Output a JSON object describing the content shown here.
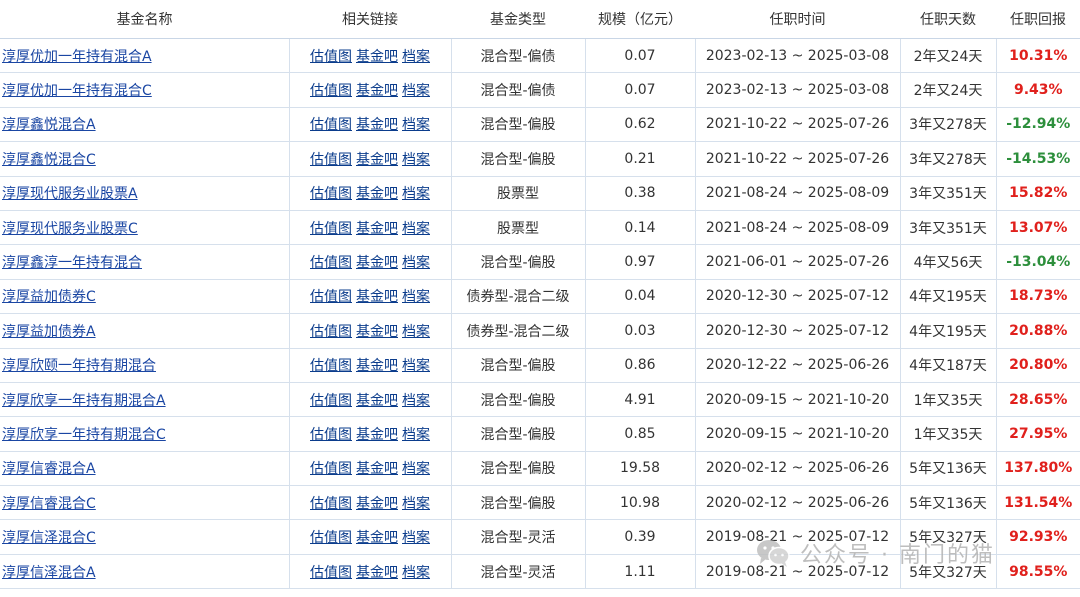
{
  "columns": {
    "name": "基金名称",
    "links": "相关链接",
    "type": "基金类型",
    "size": "规模（亿元）",
    "period": "任职时间",
    "days": "任职天数",
    "ret": "任职回报"
  },
  "link_labels": [
    "估值图",
    "基金吧",
    "档案"
  ],
  "colors": {
    "positive": "#e0201c",
    "negative": "#2d8f3c",
    "link": "#0b3c8c"
  },
  "rows": [
    {
      "name": "淳厚优加一年持有混合A",
      "type": "混合型-偏债",
      "size": "0.07",
      "period": "2023-02-13 ~ 2025-03-08",
      "days": "2年又24天",
      "ret": "10.31%",
      "sign": "pos"
    },
    {
      "name": "淳厚优加一年持有混合C",
      "type": "混合型-偏债",
      "size": "0.07",
      "period": "2023-02-13 ~ 2025-03-08",
      "days": "2年又24天",
      "ret": "9.43%",
      "sign": "pos"
    },
    {
      "name": "淳厚鑫悦混合A",
      "type": "混合型-偏股",
      "size": "0.62",
      "period": "2021-10-22 ~ 2025-07-26",
      "days": "3年又278天",
      "ret": "-12.94%",
      "sign": "neg"
    },
    {
      "name": "淳厚鑫悦混合C",
      "type": "混合型-偏股",
      "size": "0.21",
      "period": "2021-10-22 ~ 2025-07-26",
      "days": "3年又278天",
      "ret": "-14.53%",
      "sign": "neg"
    },
    {
      "name": "淳厚现代服务业股票A",
      "type": "股票型",
      "size": "0.38",
      "period": "2021-08-24 ~ 2025-08-09",
      "days": "3年又351天",
      "ret": "15.82%",
      "sign": "pos"
    },
    {
      "name": "淳厚现代服务业股票C",
      "type": "股票型",
      "size": "0.14",
      "period": "2021-08-24 ~ 2025-08-09",
      "days": "3年又351天",
      "ret": "13.07%",
      "sign": "pos"
    },
    {
      "name": "淳厚鑫淳一年持有混合",
      "type": "混合型-偏股",
      "size": "0.97",
      "period": "2021-06-01 ~ 2025-07-26",
      "days": "4年又56天",
      "ret": "-13.04%",
      "sign": "neg"
    },
    {
      "name": "淳厚益加债券C",
      "type": "债券型-混合二级",
      "size": "0.04",
      "period": "2020-12-30 ~ 2025-07-12",
      "days": "4年又195天",
      "ret": "18.73%",
      "sign": "pos"
    },
    {
      "name": "淳厚益加债券A",
      "type": "债券型-混合二级",
      "size": "0.03",
      "period": "2020-12-30 ~ 2025-07-12",
      "days": "4年又195天",
      "ret": "20.88%",
      "sign": "pos"
    },
    {
      "name": "淳厚欣颐一年持有期混合",
      "type": "混合型-偏股",
      "size": "0.86",
      "period": "2020-12-22 ~ 2025-06-26",
      "days": "4年又187天",
      "ret": "20.80%",
      "sign": "pos"
    },
    {
      "name": "淳厚欣享一年持有期混合A",
      "type": "混合型-偏股",
      "size": "4.91",
      "period": "2020-09-15 ~ 2021-10-20",
      "days": "1年又35天",
      "ret": "28.65%",
      "sign": "pos"
    },
    {
      "name": "淳厚欣享一年持有期混合C",
      "type": "混合型-偏股",
      "size": "0.85",
      "period": "2020-09-15 ~ 2021-10-20",
      "days": "1年又35天",
      "ret": "27.95%",
      "sign": "pos"
    },
    {
      "name": "淳厚信睿混合A",
      "type": "混合型-偏股",
      "size": "19.58",
      "period": "2020-02-12 ~ 2025-06-26",
      "days": "5年又136天",
      "ret": "137.80%",
      "sign": "pos"
    },
    {
      "name": "淳厚信睿混合C",
      "type": "混合型-偏股",
      "size": "10.98",
      "period": "2020-02-12 ~ 2025-06-26",
      "days": "5年又136天",
      "ret": "131.54%",
      "sign": "pos"
    },
    {
      "name": "淳厚信泽混合C",
      "type": "混合型-灵活",
      "size": "0.39",
      "period": "2019-08-21 ~ 2025-07-12",
      "days": "5年又327天",
      "ret": "92.93%",
      "sign": "pos"
    },
    {
      "name": "淳厚信泽混合A",
      "type": "混合型-灵活",
      "size": "1.11",
      "period": "2019-08-21 ~ 2025-07-12",
      "days": "5年又327天",
      "ret": "98.55%",
      "sign": "pos"
    }
  ],
  "watermark": {
    "text": "公众号 · 南门的猫",
    "icon": "wechat-icon"
  }
}
